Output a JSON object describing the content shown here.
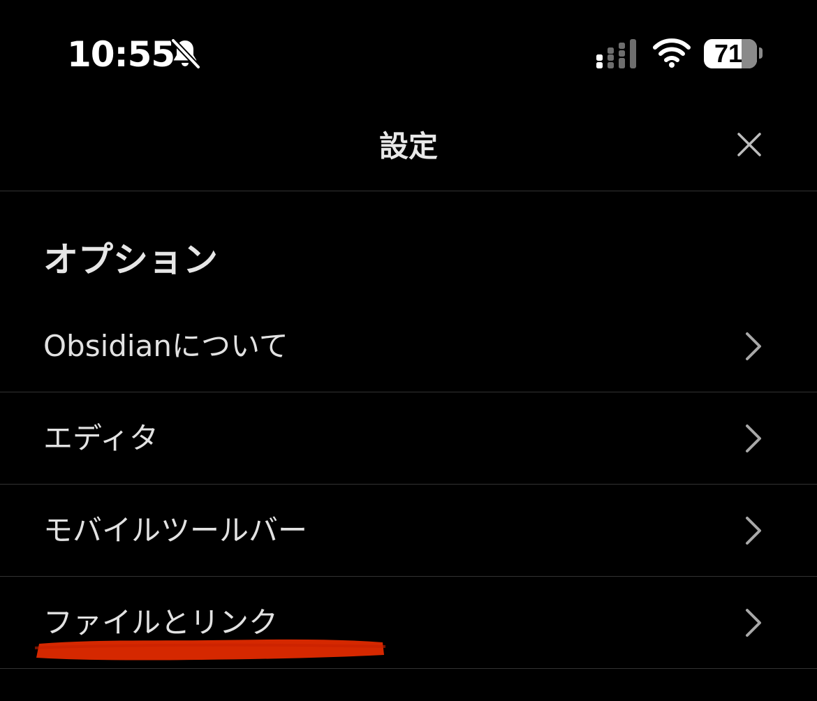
{
  "status_bar": {
    "time": "10:55",
    "battery_level": 71,
    "battery_label": "71",
    "icons": [
      "bell-slash-icon",
      "cellular-signal-icon",
      "wifi-icon",
      "battery-icon"
    ]
  },
  "header": {
    "title": "設定",
    "close_icon": "close-icon"
  },
  "section": {
    "title": "オプション"
  },
  "settings": {
    "items": [
      {
        "label": "Obsidianについて"
      },
      {
        "label": "エディタ"
      },
      {
        "label": "モバイルツールバー"
      },
      {
        "label": "ファイルとリンク"
      }
    ]
  },
  "colors": {
    "background": "#000000",
    "text": "#e2e2e2",
    "divider": "#333333",
    "redaction": "#e02a00"
  }
}
